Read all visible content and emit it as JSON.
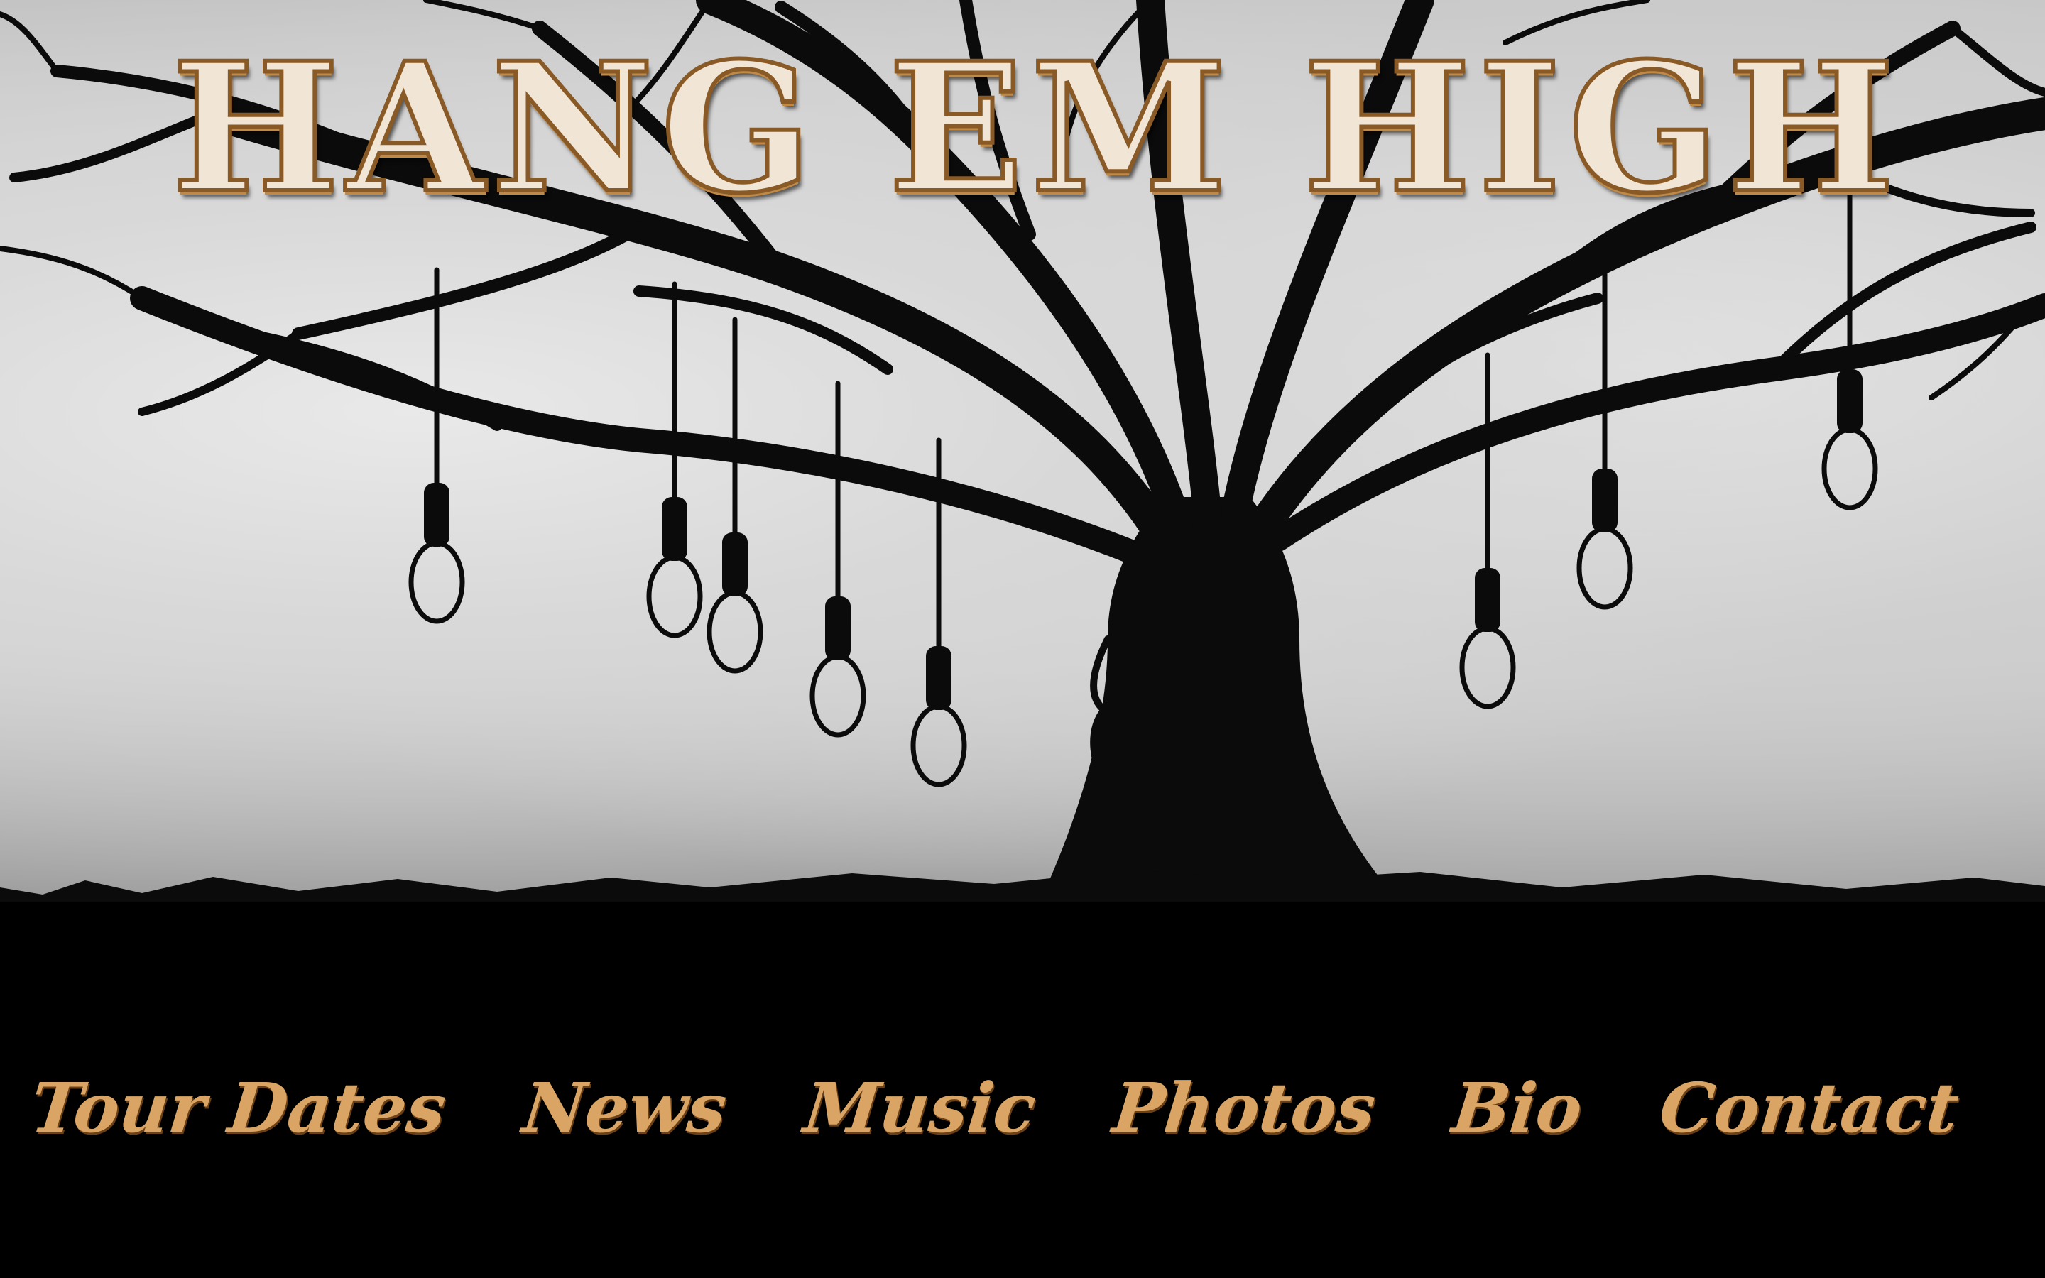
{
  "header": {
    "title": "HANG EM HIGH",
    "logo_icon": "hanging-tree-illustration"
  },
  "nav": {
    "items": [
      {
        "label": "Tour Dates"
      },
      {
        "label": "News"
      },
      {
        "label": "Music"
      },
      {
        "label": "Photos"
      },
      {
        "label": "Bio"
      },
      {
        "label": "Contact"
      }
    ]
  },
  "colors": {
    "background": "#000000",
    "sky": "#cfcfcf",
    "nav_text": "#d9a464",
    "title_fill": "#f1e6d6",
    "title_outline": "#8a5a26",
    "silhouette": "#0a0a0a"
  }
}
